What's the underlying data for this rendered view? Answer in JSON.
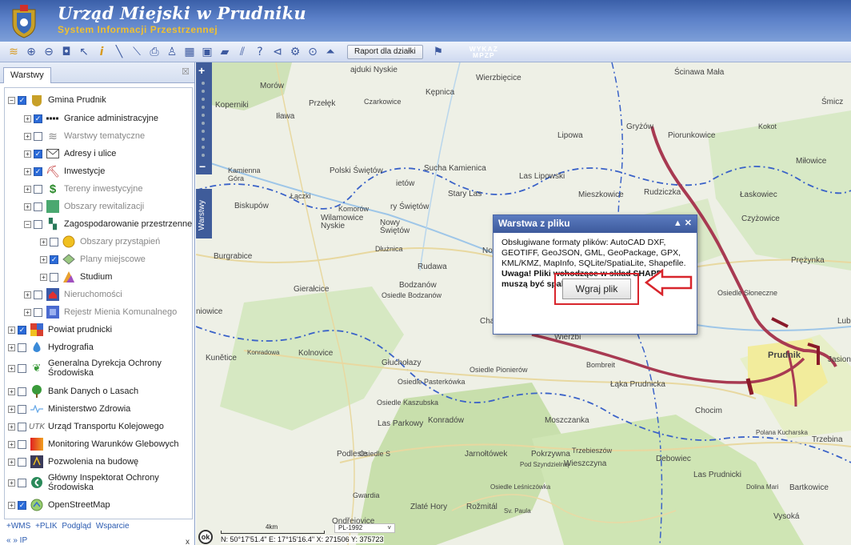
{
  "header": {
    "title": "Urząd Miejski w Prudniku",
    "subtitle": "System Informacji Przestrzennej"
  },
  "toolbar": {
    "report_label": "Raport dla działki",
    "wykaz_line1": "WYKAZ",
    "wykaz_line2": "MPZP",
    "icons": [
      "layers-icon",
      "zoom-in-icon",
      "zoom-out-icon",
      "zoom-extent-icon",
      "pointer-icon",
      "info-icon",
      "measure-line-icon",
      "measure-area-icon",
      "print-icon",
      "person-icon",
      "table-icon",
      "window-icon",
      "comment-icon",
      "hatch-icon",
      "help-icon",
      "share-icon",
      "settings-icon",
      "search-icon",
      "north-icon"
    ]
  },
  "left_panel": {
    "tab_label": "Warstwy",
    "tree": [
      {
        "label": "Gmina Prudnik",
        "checked": true,
        "level": 0,
        "expanded": true
      },
      {
        "label": "Granice administracyjne",
        "checked": true,
        "level": 1
      },
      {
        "label": "Warstwy tematyczne",
        "checked": false,
        "level": 1,
        "dim": true
      },
      {
        "label": "Adresy i ulice",
        "checked": true,
        "level": 1
      },
      {
        "label": "Inwestycje",
        "checked": true,
        "level": 1
      },
      {
        "label": "Tereny inwestycyjne",
        "checked": false,
        "level": 1,
        "dim": true
      },
      {
        "label": "Obszary rewitalizacji",
        "checked": false,
        "level": 1,
        "dim": true
      },
      {
        "label": "Zagospodarowanie przestrzenne",
        "checked": false,
        "level": 1,
        "expanded": true
      },
      {
        "label": "Obszary przystąpień",
        "checked": false,
        "level": 2,
        "dim": true
      },
      {
        "label": "Plany miejscowe",
        "checked": true,
        "level": 2,
        "dim": true
      },
      {
        "label": "Studium",
        "checked": false,
        "level": 2
      },
      {
        "label": "Nieruchomości",
        "checked": false,
        "level": 1,
        "dim": true
      },
      {
        "label": "Rejestr Mienia Komunalnego",
        "checked": false,
        "level": 1,
        "dim": true
      },
      {
        "label": "Powiat prudnicki",
        "checked": true,
        "level": 0
      },
      {
        "label": "Hydrografia",
        "checked": false,
        "level": 0
      },
      {
        "label": "Generalna Dyrekcja Ochrony Środowiska",
        "checked": false,
        "level": 0
      },
      {
        "label": "Bank Danych o Lasach",
        "checked": false,
        "level": 0
      },
      {
        "label": "Ministerstwo Zdrowia",
        "checked": false,
        "level": 0
      },
      {
        "label": "Urząd Transportu Kolejowego",
        "checked": false,
        "level": 0
      },
      {
        "label": "Monitoring Warunków Glebowych",
        "checked": false,
        "level": 0
      },
      {
        "label": "Pozwolenia na budowę",
        "checked": false,
        "level": 0
      },
      {
        "label": "Główny Inspektorat Ochrony Środowiska",
        "checked": false,
        "level": 0
      },
      {
        "label": "OpenStreetMap",
        "checked": true,
        "level": 0
      }
    ],
    "links": [
      "+WMS",
      "+PLIK",
      "Podgląd",
      "Wsparcie"
    ],
    "nav": "« »  IP",
    "nav_close": "x"
  },
  "map": {
    "side_tab_label": "Warstwy",
    "labels": [
      "ajduki Nyskie",
      "Wierzbięcice",
      "Kępnica",
      "Ścinawa Mała",
      "Morów",
      "Koperniki",
      "Przełęk",
      "Czarkowice",
      "Iława",
      "Śmicz",
      "Gryżów",
      "Piorunkowice",
      "Lipowa",
      "Kokot",
      "Sucha Kamienica",
      "Polski Świętów",
      "Kamienna Góra",
      "Las Lipowski",
      "Mieszkowice",
      "Rudziczka",
      "Miłowice",
      "Łaskowiec",
      "ietów",
      "Stary Las",
      "Łączki",
      "Biskupów",
      "Komorów",
      "Wilamowice Nyskie",
      "Nowy Świętów",
      "ry Świętów",
      "Burgrabice",
      "Dłużnica",
      "Rudawa",
      "Nowy",
      "Czyżowice",
      "Prężynka",
      "Osiedle Słoneczne",
      "Gierałcice",
      "Bodzanów",
      "Osiedle Bodzanów",
      "Cha",
      "Lub",
      "niowice",
      "Kunětice",
      "Konradowa",
      "Kolnovice",
      "Głuchołazy",
      "Osiedle Pionierów",
      "Bombreit",
      "Wierzbi",
      "Osiedle Pasterkówka",
      "Łąka Prudnicka",
      "Prudnik",
      "Jasiona",
      "Osiedle Kaszubska",
      "Chocim",
      "Las Parkowy",
      "Konradów",
      "Moszczanka",
      "Trzebina",
      "Polana Kucharska",
      "Podlesie",
      "Osiedle S",
      "Jarnołtówek",
      "Pokrzywna",
      "Trzebieszów",
      "Debowiec",
      "Pod Szyndzielnią",
      "Wieszczyna",
      "Las Prudnicki",
      "Dolina Mari",
      "Bartkowice",
      "Osiedle Leśniczówka",
      "Gwardia",
      "Zlaté Hory",
      "Rožmitál",
      "Ondřejovice",
      "Vysoká",
      "Sv. Paula"
    ]
  },
  "popup": {
    "title": "Warstwa z pliku",
    "controls": "▲ ✕",
    "text": "Obsługiwane formaty plików: AutoCAD DXF, GEOTIFF, GeoJSON, GML, GeoPackage, GPX, KML/KMZ, MapInfo, SQLite/SpatiaLite, Shapefile.",
    "warning": "Uwaga! Pliki wchodzące w skład SHAPE muszą być spakowane do ZIP.",
    "button_label": "Wgraj plik"
  },
  "status": {
    "ok_label": "ok",
    "scale_label": "4km",
    "projection": "PL-1992",
    "coords": "N: 50°17'51.4\"  E: 17°15'16.4\"   X: 271506     Y: 375723"
  },
  "colors": {
    "header": "#4a6db5",
    "subtitle": "#f0c030",
    "accent_red": "#d8252c",
    "road": "#a83a52",
    "boundary": "#3a62c8"
  }
}
